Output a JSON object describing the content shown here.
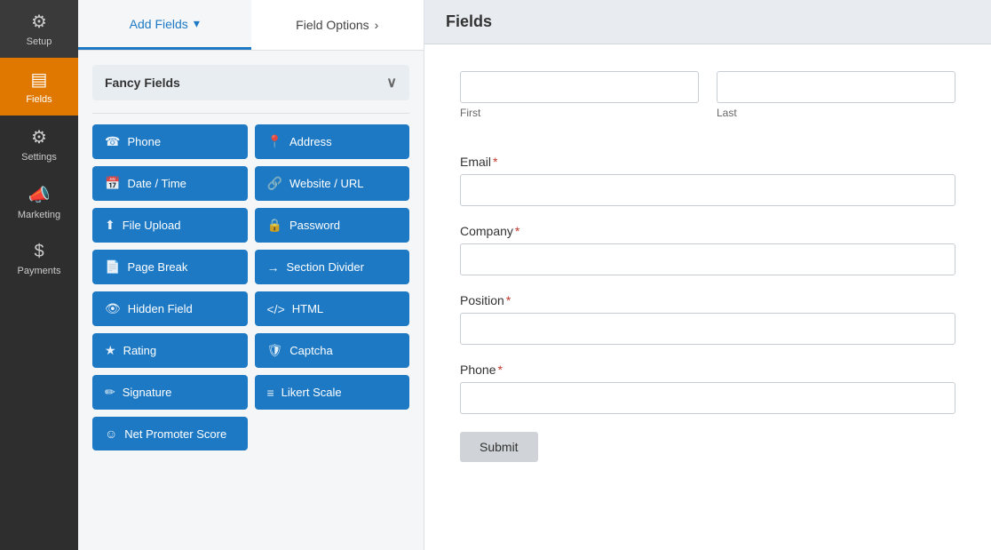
{
  "sidebar": {
    "items": [
      {
        "id": "setup",
        "label": "Setup",
        "icon": "⚙",
        "active": false
      },
      {
        "id": "fields",
        "label": "Fields",
        "icon": "▤",
        "active": true
      },
      {
        "id": "settings",
        "label": "Settings",
        "icon": "☰",
        "active": false
      },
      {
        "id": "marketing",
        "label": "Marketing",
        "icon": "📣",
        "active": false
      },
      {
        "id": "payments",
        "label": "Payments",
        "icon": "$",
        "active": false
      }
    ]
  },
  "tabs": [
    {
      "id": "add-fields",
      "label": "Add Fields",
      "active": true,
      "chevron": "▾"
    },
    {
      "id": "field-options",
      "label": "Field Options",
      "active": false,
      "chevron": "›"
    }
  ],
  "fancy_fields_section": {
    "title": "Fancy Fields",
    "chevron": "∨"
  },
  "field_buttons": [
    {
      "id": "phone",
      "label": "Phone",
      "icon": "☎"
    },
    {
      "id": "address",
      "label": "Address",
      "icon": "📍"
    },
    {
      "id": "date-time",
      "label": "Date / Time",
      "icon": "📅"
    },
    {
      "id": "website-url",
      "label": "Website / URL",
      "icon": "🔗"
    },
    {
      "id": "file-upload",
      "label": "File Upload",
      "icon": "⬆"
    },
    {
      "id": "password",
      "label": "Password",
      "icon": "🔒"
    },
    {
      "id": "page-break",
      "label": "Page Break",
      "icon": "📄"
    },
    {
      "id": "section-divider",
      "label": "Section Divider",
      "icon": "→"
    },
    {
      "id": "hidden-field",
      "label": "Hidden Field",
      "icon": "👁"
    },
    {
      "id": "html",
      "label": "HTML",
      "icon": "⟨/⟩"
    },
    {
      "id": "rating",
      "label": "Rating",
      "icon": "★"
    },
    {
      "id": "captcha",
      "label": "Captcha",
      "icon": "🛡"
    },
    {
      "id": "signature",
      "label": "Signature",
      "icon": "✏"
    },
    {
      "id": "likert-scale",
      "label": "Likert Scale",
      "icon": "≡"
    },
    {
      "id": "net-promoter-score",
      "label": "Net Promoter Score",
      "icon": "☺"
    }
  ],
  "right_panel": {
    "title": "Fields"
  },
  "form": {
    "fields": [
      {
        "id": "first",
        "sub_label": "First",
        "type": "text-small",
        "required": false
      },
      {
        "id": "last",
        "sub_label": "Last",
        "type": "text-small",
        "required": false
      },
      {
        "id": "email",
        "label": "Email",
        "required": true
      },
      {
        "id": "company",
        "label": "Company",
        "required": true
      },
      {
        "id": "position",
        "label": "Position",
        "required": true
      },
      {
        "id": "phone",
        "label": "Phone",
        "required": true
      }
    ],
    "submit_label": "Submit"
  }
}
